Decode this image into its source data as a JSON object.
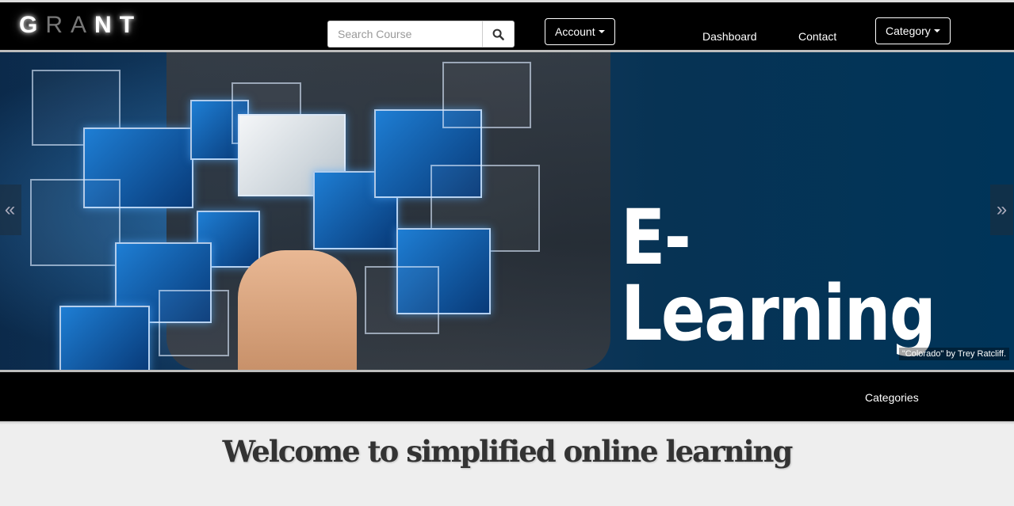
{
  "header": {
    "logo_letters": [
      "G",
      "R",
      "A",
      "N",
      "T"
    ],
    "search": {
      "placeholder": "Search Course",
      "value": ""
    },
    "account_label": "Account",
    "dashboard_label": "Dashboard",
    "contact_label": "Contact",
    "category_label": "Category"
  },
  "hero": {
    "title": "E-Learning",
    "credit": "\"Colorado\" by Trey Ratcliff.",
    "prev_symbol": "«",
    "next_symbol": "»"
  },
  "subbar": {
    "categories_label": "Categories"
  },
  "main": {
    "welcome": "Welcome to simplified online learning"
  },
  "colors": {
    "bar": "#000000",
    "page_bg": "#eeeeee",
    "hero_bg": "#003459"
  }
}
